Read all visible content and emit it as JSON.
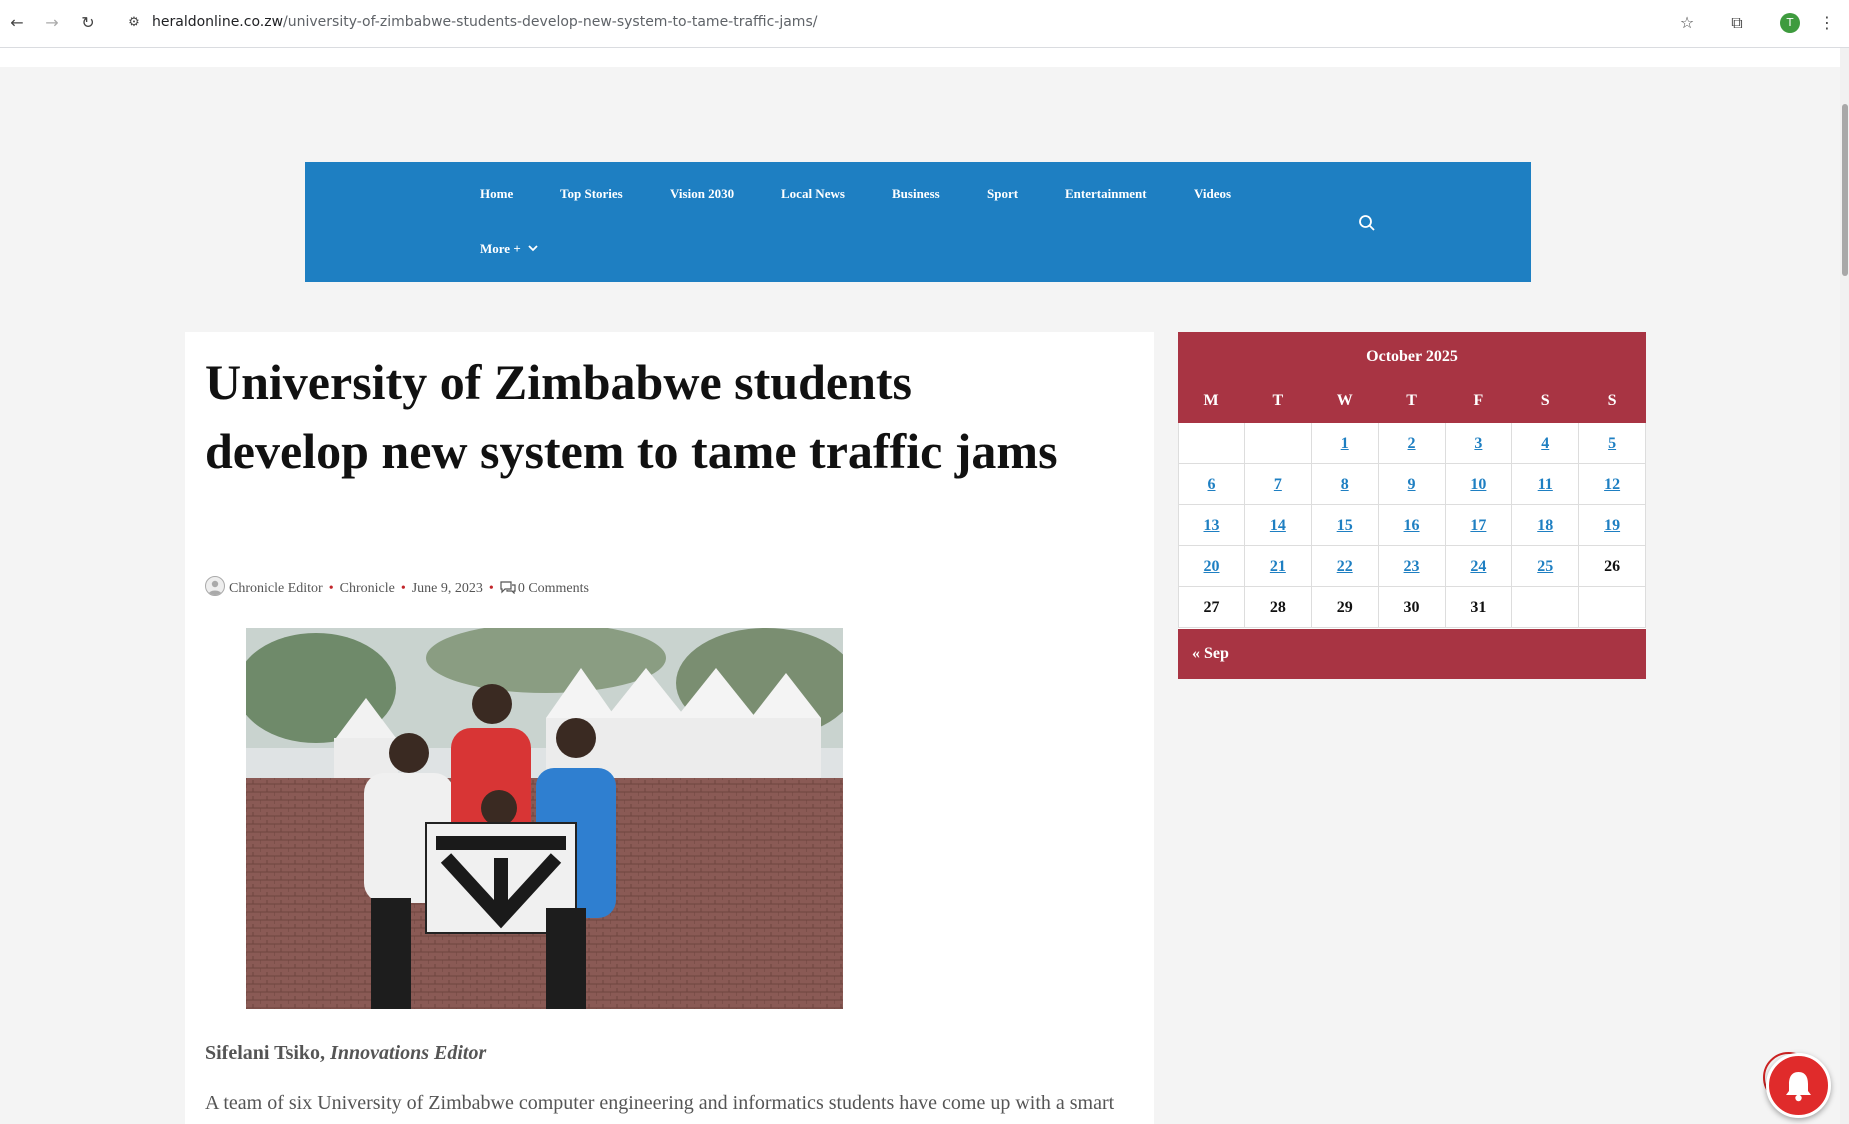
{
  "browser": {
    "url_domain": "heraldonline.co.zw",
    "url_path": "/university-of-zimbabwe-students-develop-new-system-to-tame-traffic-jams/",
    "profile_initial": "T"
  },
  "nav": {
    "items": [
      "Home",
      "Top Stories",
      "Vision 2030",
      "Local News",
      "Business",
      "Sport",
      "Entertainment",
      "Videos"
    ],
    "more_label": "More +"
  },
  "article": {
    "title": "University of Zimbabwe students develop new system to tame traffic jams",
    "meta": {
      "author": "Chronicle Editor",
      "category": "Chronicle",
      "date": "June 9, 2023",
      "comments": "0 Comments"
    },
    "byline_name": "Sifelani Tsiko,",
    "byline_role": "Innovations Editor",
    "first_paragraph": "A team of six University of Zimbabwe computer engineering and informatics students have come up with a smart"
  },
  "calendar": {
    "title": "October 2025",
    "weekdays": [
      "M",
      "T",
      "W",
      "T",
      "F",
      "S",
      "S"
    ],
    "weeks": [
      [
        "",
        "",
        "1",
        "2",
        "3",
        "4",
        "5"
      ],
      [
        "6",
        "7",
        "8",
        "9",
        "10",
        "11",
        "12"
      ],
      [
        "13",
        "14",
        "15",
        "16",
        "17",
        "18",
        "19"
      ],
      [
        "20",
        "21",
        "22",
        "23",
        "24",
        "25",
        "26"
      ],
      [
        "27",
        "28",
        "29",
        "30",
        "31",
        "",
        ""
      ]
    ],
    "linked_through_day": 25,
    "prev_label": "« Sep"
  },
  "colors": {
    "nav_bg": "#1e7fc2",
    "calendar_accent": "#a83443",
    "link": "#1e7fc2"
  }
}
